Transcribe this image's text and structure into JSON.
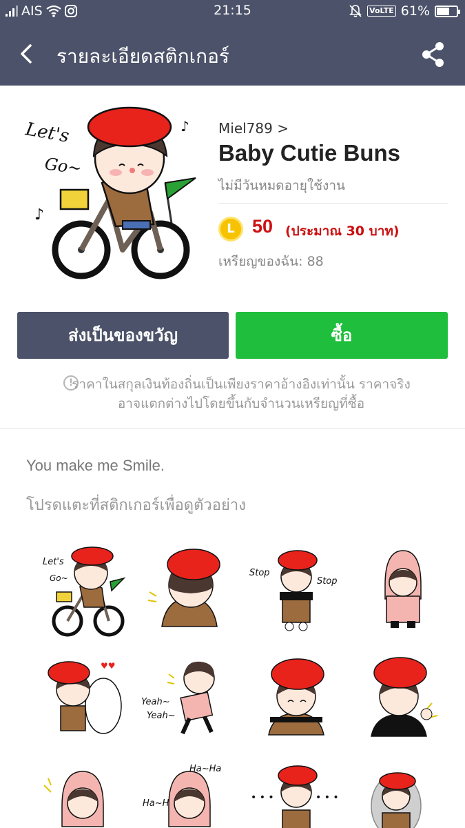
{
  "status_bar": {
    "carrier": "AIS",
    "time": "21:15",
    "volte": "VoLTE",
    "battery": "61%"
  },
  "nav": {
    "title": "รายละเอียดสติกเกอร์",
    "back_icon": "chevron-left-icon",
    "share_icon": "share-icon"
  },
  "sticker_pack": {
    "author": "Miel789 >",
    "title": "Baby Cutie Buns",
    "validity": "ไม่มีวันหมดอายุใช้งาน",
    "coin_symbol": "L",
    "price": "50",
    "price_approx": "(ประมาณ 30 บาท)",
    "my_coins": "เหรียญของฉัน: 88"
  },
  "buttons": {
    "gift": "ส่งเป็นของขวัญ",
    "buy": "ซื้อ"
  },
  "notice": {
    "icon": "!",
    "text": "ราคาในสกุลเงินท้องถิ่นเป็นเพียงราคาอ้างอิงเท่านั้น ราคาจริงอาจแตกต่างไปโดยขึ้นกับจำนวนเหรียญที่ซื้อ"
  },
  "description": "You make me Smile.",
  "preview_hint": "โปรดแตะที่สติกเกอร์เพื่อดูตัวอย่าง",
  "sticker_texts": {
    "lets_go_1": "Let's",
    "lets_go_2": "Go~",
    "stop": "Stop",
    "yeah": "Yeah~",
    "haha": "Ha~Ha"
  },
  "colors": {
    "header_bg": "#4b5269",
    "buy_green": "#1fbe3c",
    "price_red": "#cc1010",
    "coin_gold": "#f7c300"
  }
}
